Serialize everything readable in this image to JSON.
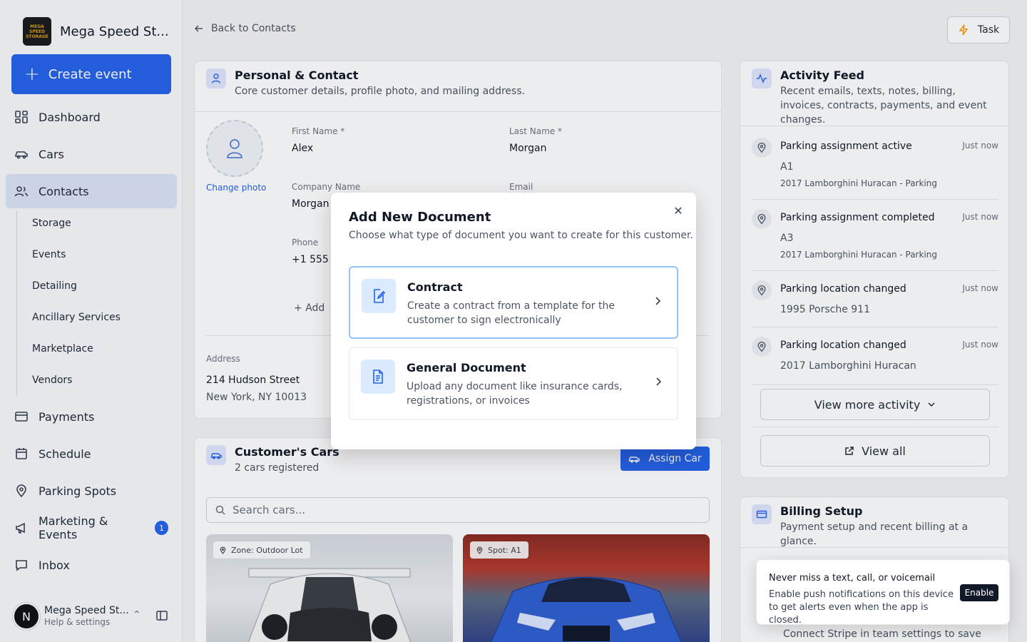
{
  "brand": {
    "name": "Mega Speed St...",
    "logo_text": "MEGA SPEED STORAGE"
  },
  "sidebar": {
    "create_label": "Create event",
    "items": [
      {
        "label": "Dashboard",
        "icon": "dashboard-icon"
      },
      {
        "label": "Cars",
        "icon": "car-icon"
      },
      {
        "label": "Contacts",
        "icon": "users-icon",
        "active": true
      },
      {
        "label": "Payments",
        "icon": "card-icon"
      },
      {
        "label": "Schedule",
        "icon": "calendar-icon"
      },
      {
        "label": "Parking Spots",
        "icon": "pin-icon"
      },
      {
        "label": "Marketing & Events",
        "icon": "megaphone-icon",
        "badge": "1"
      },
      {
        "label": "Inbox",
        "icon": "inbox-icon"
      }
    ],
    "subitems": [
      "Storage",
      "Events",
      "Detailing",
      "Ancillary Services",
      "Marketplace",
      "Vendors"
    ],
    "user": {
      "initial": "N",
      "name": "Mega Speed St...",
      "sub": "Help & settings"
    }
  },
  "header": {
    "back_label": "Back to Contacts",
    "task_label": "Task"
  },
  "personal": {
    "title": "Personal & Contact",
    "subtitle": "Core customer details, profile photo, and mailing address.",
    "change_photo": "Change photo",
    "first_name_label": "First Name *",
    "first_name": "Alex",
    "last_name_label": "Last Name *",
    "last_name": "Morgan",
    "company_label": "Company Name",
    "company": "Morgan",
    "email_label": "Email",
    "phone_label": "Phone",
    "phone": "+1 555 5",
    "add_label": "Add",
    "address_label": "Address",
    "address_line1": "214 Hudson Street",
    "address_line2": "New York, NY 10013"
  },
  "cars": {
    "title": "Customer's Cars",
    "subtitle": "2 cars registered",
    "assign_label": "Assign Car",
    "search_placeholder": "Search cars...",
    "list": [
      {
        "chip": "Zone: Outdoor Lot"
      },
      {
        "chip": "Spot: A1"
      }
    ]
  },
  "activity": {
    "title": "Activity Feed",
    "subtitle": "Recent emails, texts, notes, billing, invoices, contracts, payments, and event changes.",
    "items": [
      {
        "title": "Parking assignment active",
        "time": "Just now",
        "line1": "A1",
        "line2": "2017 Lamborghini Huracan - Parking"
      },
      {
        "title": "Parking assignment completed",
        "time": "Just now",
        "line1": "A3",
        "line2": "2017 Lamborghini Huracan - Parking"
      },
      {
        "title": "Parking location changed",
        "time": "Just now",
        "line1": "1995 Porsche 911",
        "line2": ""
      },
      {
        "title": "Parking location changed",
        "time": "Just now",
        "line1": "2017 Lamborghini Huracan",
        "line2": ""
      }
    ],
    "view_more_label": "View more activity",
    "view_all_label": "View all"
  },
  "billing": {
    "title": "Billing Setup",
    "subtitle": "Payment setup and recent billing at a glance.",
    "stripe_note": "Connect Stripe in team settings to save"
  },
  "modal": {
    "title": "Add New Document",
    "subtitle": "Choose what type of document you want to create for this customer.",
    "options": [
      {
        "title": "Contract",
        "desc": "Create a contract from a template for the customer to sign electronically",
        "icon": "contract-edit-icon"
      },
      {
        "title": "General Document",
        "desc": "Upload any document like insurance cards, registrations, or invoices",
        "icon": "document-icon"
      }
    ]
  },
  "toast": {
    "title": "Never miss a text, call, or voicemail",
    "body": "Enable push notifications on this device to get alerts even when the app is closed.",
    "button": "Enable"
  },
  "colors": {
    "accent": "#2563eb",
    "accent_light": "#dbeafe",
    "text": "#111827",
    "muted": "#6b7280"
  }
}
